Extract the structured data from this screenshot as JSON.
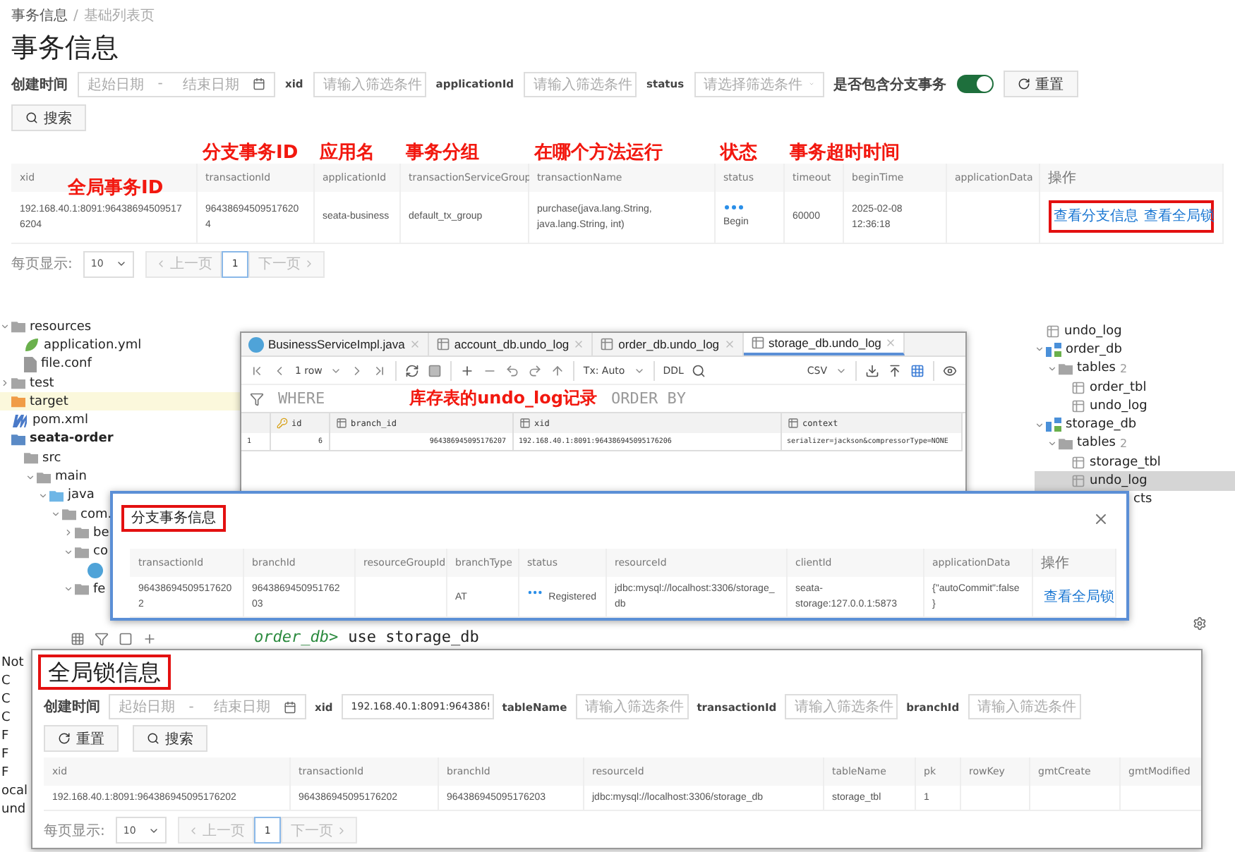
{
  "seata_page": {
    "breadcrumb": [
      "事务信息",
      "基础列表页"
    ],
    "breadcrumb_separator": "/",
    "title": "事务信息",
    "filters": [
      {
        "kind": "daterange",
        "label": "创建时间",
        "start_placeholder": "起始日期",
        "separator": "-",
        "end_placeholder": "结束日期"
      },
      {
        "kind": "text",
        "label": "xid",
        "placeholder": "请输入筛选条件"
      },
      {
        "kind": "text",
        "label": "applicationId",
        "placeholder": "请输入筛选条件"
      },
      {
        "kind": "select",
        "label": "status",
        "placeholder": "请选择筛选条件"
      },
      {
        "kind": "switch",
        "label": "是否包含分支事务",
        "on": true
      },
      {
        "kind": "reset",
        "label": "重置"
      }
    ],
    "search_button": "搜索",
    "table": {
      "columns": [
        {
          "label": "xid",
          "kind": "text",
          "note": "全局事务ID"
        },
        {
          "label": "transactionId",
          "kind": "text",
          "note": "分支事务ID"
        },
        {
          "label": "applicationId",
          "kind": "text",
          "note": "应用名"
        },
        {
          "label": "transactionServiceGroup",
          "kind": "text",
          "note": "事务分组"
        },
        {
          "label": "transactionName",
          "kind": "text",
          "note": "在哪个方法运行"
        },
        {
          "label": "status",
          "kind": "status",
          "note": "状态"
        },
        {
          "label": "timeout",
          "kind": "text",
          "note": "事务超时时间"
        },
        {
          "label": "beginTime",
          "kind": "text"
        },
        {
          "label": "applicationData",
          "kind": "text"
        },
        {
          "label": "操作",
          "kind": "actions",
          "boxed": true
        }
      ],
      "rows": [
        [
          "192.168.40.1:8091:964386945095176204",
          "964386945095176204",
          "seata-business",
          "default_tx_group",
          "purchase(java.lang.String, java.lang.String, int)",
          "Begin",
          "60000",
          "2025-02-08 12:36:18",
          null,
          [
            "查看分支信息",
            "查看全局锁"
          ]
        ]
      ]
    },
    "pagination": {
      "label": "每页显示:",
      "page_size": "10",
      "prev": "上一页",
      "pages": [
        {
          "label": "1",
          "selected": true
        }
      ],
      "next": "下一页"
    }
  },
  "project_tree": [
    {
      "label": "resources",
      "kind": "resource-folder",
      "expanded": true,
      "children": [
        {
          "label": "application.yml",
          "kind": "yaml"
        },
        {
          "label": "file.conf",
          "kind": "file"
        }
      ]
    },
    {
      "label": "test",
      "kind": "folder",
      "expanded": false
    },
    {
      "label": "target",
      "kind": "excluded-folder",
      "highlighted": true
    },
    {
      "label": "pom.xml",
      "kind": "maven"
    },
    {
      "label": "seata-order",
      "kind": "module",
      "children": [
        {
          "label": "src",
          "kind": "folder",
          "children": [
            {
              "label": "main",
              "kind": "folder",
              "expanded": true,
              "children": [
                {
                  "label": "java",
                  "kind": "source-folder",
                  "expanded": true,
                  "children": [
                    {
                      "label": "com.",
                      "kind": "package",
                      "expanded": true,
                      "children": [
                        {
                          "label": "be",
                          "kind": "package",
                          "expanded": false
                        },
                        {
                          "label": "co",
                          "kind": "package",
                          "expanded": true,
                          "children": [
                            {
                              "kind": "class"
                            }
                          ]
                        },
                        {
                          "label": "fe",
                          "kind": "package",
                          "expanded": true
                        }
                      ]
                    }
                  ]
                }
              ]
            }
          ]
        }
      ]
    }
  ],
  "ide_lower_left": {
    "items": [
      "Not",
      "C",
      "C",
      "C",
      "F",
      "F",
      "F",
      "ocal",
      "und"
    ]
  },
  "terminal_line": {
    "prompt": "order_db>",
    "command": "use storage_db"
  },
  "db_tree": [
    {
      "label": "undo_log",
      "kind": "table",
      "selected": false
    },
    {
      "label": "order_db",
      "kind": "schema",
      "expanded": true,
      "selected": false,
      "children": [
        {
          "label": "tables",
          "count": "2",
          "kind": "folder",
          "expanded": true,
          "selected": false,
          "children": [
            {
              "label": "order_tbl",
              "kind": "table",
              "selected": false
            },
            {
              "label": "undo_log",
              "kind": "table",
              "selected": false
            }
          ]
        }
      ]
    },
    {
      "label": "storage_db",
      "kind": "schema",
      "expanded": true,
      "selected": false,
      "children": [
        {
          "label": "tables",
          "count": "2",
          "kind": "folder",
          "expanded": true,
          "selected": false,
          "children": [
            {
              "label": "storage_tbl",
              "kind": "table",
              "selected": false
            },
            {
              "label": "undo_log",
              "kind": "table",
              "selected": true
            }
          ]
        }
      ]
    },
    {
      "label": "cts",
      "kind": "plain",
      "selected": false
    }
  ],
  "grid_window": {
    "tabs": [
      {
        "label": "BusinessServiceImpl.java",
        "kind": "class",
        "selected": false
      },
      {
        "label": "account_db.undo_log",
        "kind": "table",
        "selected": false
      },
      {
        "label": "order_db.undo_log",
        "kind": "table",
        "selected": false
      },
      {
        "label": "storage_db.undo_log",
        "kind": "table",
        "selected": true
      }
    ],
    "rows_label": "1 row",
    "tx_mode": "Tx: Auto",
    "ddl": "DDL",
    "format": "CSV",
    "where": "WHERE",
    "note": "库存表的undo_log记录",
    "order_by": "ORDER BY",
    "columns": [
      {
        "label": "id",
        "kind": "key"
      },
      {
        "label": "branch_id",
        "kind": "column"
      },
      {
        "label": "xid",
        "kind": "column"
      },
      {
        "label": "context",
        "kind": "column"
      }
    ],
    "rows": [
      {
        "number": "1",
        "cells": [
          "6",
          "964386945095176207",
          "192.168.40.1:8091:964386945095176206",
          "serializer=jackson&compressorType=NONE"
        ]
      }
    ]
  },
  "branch_dialog": {
    "title": "分支事务信息",
    "boxed": true,
    "columns": [
      {
        "label": "transactionId",
        "kind": "text"
      },
      {
        "label": "branchId",
        "kind": "text"
      },
      {
        "label": "resourceGroupId",
        "kind": "text"
      },
      {
        "label": "branchType",
        "kind": "text"
      },
      {
        "label": "status",
        "kind": "status"
      },
      {
        "label": "resourceId",
        "kind": "text"
      },
      {
        "label": "clientId",
        "kind": "text"
      },
      {
        "label": "applicationData",
        "kind": "text"
      },
      {
        "label": "操作",
        "kind": "actions"
      }
    ],
    "rows": [
      [
        "964386945095176202",
        "964386945095176203",
        null,
        "AT",
        "Registered",
        "jdbc:mysql://localhost:3306/storage_db",
        "seata-storage:127.0.0.1:5873",
        "{\"autoCommit\":false}",
        [
          "查看全局锁"
        ]
      ]
    ]
  },
  "lock_window": {
    "title": "全局锁信息",
    "boxed": true,
    "filters": [
      {
        "kind": "daterange",
        "label": "创建时间",
        "start_placeholder": "起始日期",
        "separator": "-",
        "end_placeholder": "结束日期"
      },
      {
        "kind": "text",
        "label": "xid",
        "value": "192.168.40.1:8091:964386!"
      },
      {
        "kind": "text",
        "label": "tableName",
        "placeholder": "请输入筛选条件"
      },
      {
        "kind": "text",
        "label": "transactionId",
        "placeholder": "请输入筛选条件"
      },
      {
        "kind": "text",
        "label": "branchId",
        "placeholder": "请输入筛选条件"
      }
    ],
    "buttons": [
      {
        "kind": "reset",
        "label": "重置"
      },
      {
        "kind": "search",
        "label": "搜索"
      }
    ],
    "columns": [
      {
        "label": "xid"
      },
      {
        "label": "transactionId"
      },
      {
        "label": "branchId"
      },
      {
        "label": "resourceId"
      },
      {
        "label": "tableName"
      },
      {
        "label": "pk"
      },
      {
        "label": "rowKey"
      },
      {
        "label": "gmtCreate"
      },
      {
        "label": "gmtModified"
      }
    ],
    "rows": [
      [
        "192.168.40.1:8091:964386945095176202",
        "964386945095176202",
        "964386945095176203",
        "jdbc:mysql://localhost:3306/storage_db",
        "storage_tbl",
        "1",
        null,
        null,
        null
      ]
    ],
    "pagination": {
      "label": "每页显示:",
      "page_size": "10",
      "prev": "上一页",
      "pages": [
        {
          "label": "1",
          "selected": true
        }
      ],
      "next": "下一页"
    }
  }
}
